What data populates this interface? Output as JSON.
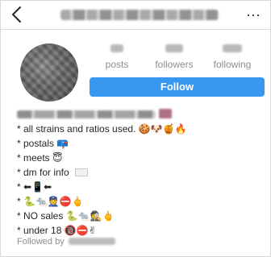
{
  "header": {
    "back_icon": "chevron-left-icon",
    "more_label": "···"
  },
  "stats": {
    "posts_label": "posts",
    "followers_label": "followers",
    "following_label": "following"
  },
  "follow_button": {
    "label": "Follow",
    "color": "#3897f0"
  },
  "bio": {
    "lines": [
      {
        "text": "* all strains and ratios used.",
        "emoji": "🍪🐶🍯🔥"
      },
      {
        "text": "* postals",
        "emoji": "📪"
      },
      {
        "text": "* meets",
        "emoji": "😇"
      },
      {
        "text": "* dm for info",
        "emoji": ""
      },
      {
        "text": "*",
        "emoji": "⬅📱⬅"
      },
      {
        "text": "*",
        "emoji": "🐍🐀👮⛔🖕"
      },
      {
        "text": "* NO sales",
        "emoji": "🐍🐀🕵🖕"
      },
      {
        "text": "* under 18",
        "emoji": "🔞⛔✌"
      }
    ]
  },
  "followed_by": {
    "label": "Followed by"
  }
}
